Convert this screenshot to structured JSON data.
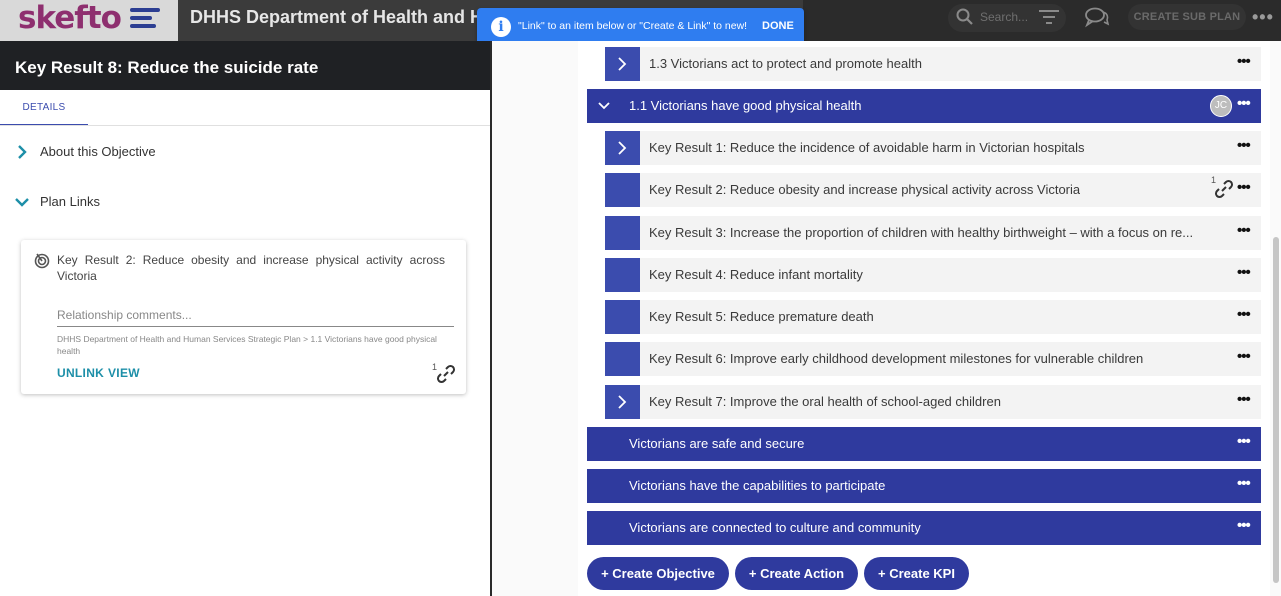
{
  "app": {
    "logo_text": "skefto",
    "title": "DHHS Department of Health and Human Services Strategic Plan",
    "search_placeholder": "Search...",
    "create_sub_plan_label": "CREATE SUB PLAN"
  },
  "toast": {
    "icon": "info-icon",
    "info_glyph": "i",
    "message": "\"Link\" to an item below or \"Create & Link\" to new!",
    "done_label": "DONE"
  },
  "left_panel": {
    "title": "Key Result 8: Reduce the suicide rate",
    "tab_label": "DETAILS",
    "sections": [
      {
        "label": "About this Objective",
        "expanded": false
      },
      {
        "label": "Plan Links",
        "expanded": true
      }
    ],
    "link_card": {
      "title": "Key Result 2: Reduce obesity and increase physical activity across Victoria",
      "comments_placeholder": "Relationship comments...",
      "breadcrumb": "DHHS Department of Health and Human Services Strategic Plan > 1.1 Victorians have good physical health",
      "unlink_label": "UNLINK",
      "view_label": "VIEW",
      "link_count": "1"
    }
  },
  "plan": {
    "rows": [
      {
        "type": "key_result",
        "label": "1.3 Victorians act to protect and promote health",
        "has_children": true
      },
      {
        "type": "objective",
        "label": "1.1 Victorians have good physical health",
        "expanded": true,
        "avatar": "JC"
      },
      {
        "type": "key_result",
        "label": "Key Result 1: Reduce the incidence of avoidable harm in Victorian hospitals",
        "has_children": true
      },
      {
        "type": "key_result",
        "label": "Key Result 2: Reduce obesity and increase physical activity across Victoria",
        "has_children": false,
        "link_count": "1"
      },
      {
        "type": "key_result",
        "label": "Key Result 3: Increase the proportion of children with healthy birthweight – with a focus on re...",
        "has_children": false
      },
      {
        "type": "key_result",
        "label": "Key Result 4: Reduce infant mortality",
        "has_children": false
      },
      {
        "type": "key_result",
        "label": "Key Result 5: Reduce premature death",
        "has_children": false
      },
      {
        "type": "key_result",
        "label": "Key Result 6: Improve early childhood development milestones for vulnerable children",
        "has_children": false
      },
      {
        "type": "key_result",
        "label": "Key Result 7: Improve the oral health of school-aged children",
        "has_children": true
      },
      {
        "type": "objective",
        "label": "Victorians are safe and secure",
        "expanded": false
      },
      {
        "type": "objective",
        "label": "Victorians have the capabilities to participate",
        "expanded": false
      },
      {
        "type": "objective",
        "label": "Victorians are connected to culture and community",
        "expanded": false
      }
    ],
    "more_glyph": "•••",
    "buttons": {
      "create_objective": "+ Create Objective",
      "create_action": "+ Create Action",
      "create_kpi": "+ Create KPI"
    }
  },
  "colors": {
    "primary": "#2f3a9e",
    "key_result_block": "#3b4cae",
    "toast": "#2f7df0",
    "link_accent": "#1d8fa8",
    "logo": "#8e2f6f"
  }
}
